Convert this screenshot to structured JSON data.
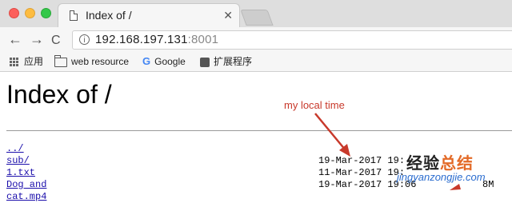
{
  "tab": {
    "title": "Index of /",
    "close": "✕"
  },
  "toolbar": {
    "back": "←",
    "forward": "→",
    "reload": "C",
    "info": "i"
  },
  "address": {
    "host": "192.168.197.131",
    "port": ":8001"
  },
  "bookmarks": [
    {
      "label": "应用",
      "icon": "apps-grid-icon"
    },
    {
      "label": "web resource",
      "icon": "folder-icon"
    },
    {
      "label": "Google",
      "icon": "google-icon"
    },
    {
      "label": "扩展程序",
      "icon": "puzzle-icon"
    }
  ],
  "page": {
    "heading": "Index of /",
    "files": [
      {
        "name": "../",
        "date": "",
        "size": ""
      },
      {
        "name": "sub/",
        "date": "19-Mar-2017 19:",
        "size": ""
      },
      {
        "name": "1.txt",
        "date": "11-Mar-2017 19:",
        "size": ""
      },
      {
        "name": "Dog and cat.mp4",
        "date": "19-Mar-2017 19:06",
        "size": "8M"
      }
    ]
  },
  "annotation": {
    "text": "my local time",
    "color": "#c8392b"
  },
  "watermark": {
    "cn_a": "经验",
    "cn_b": "总结",
    "en": "jingyanzongjie.com"
  }
}
